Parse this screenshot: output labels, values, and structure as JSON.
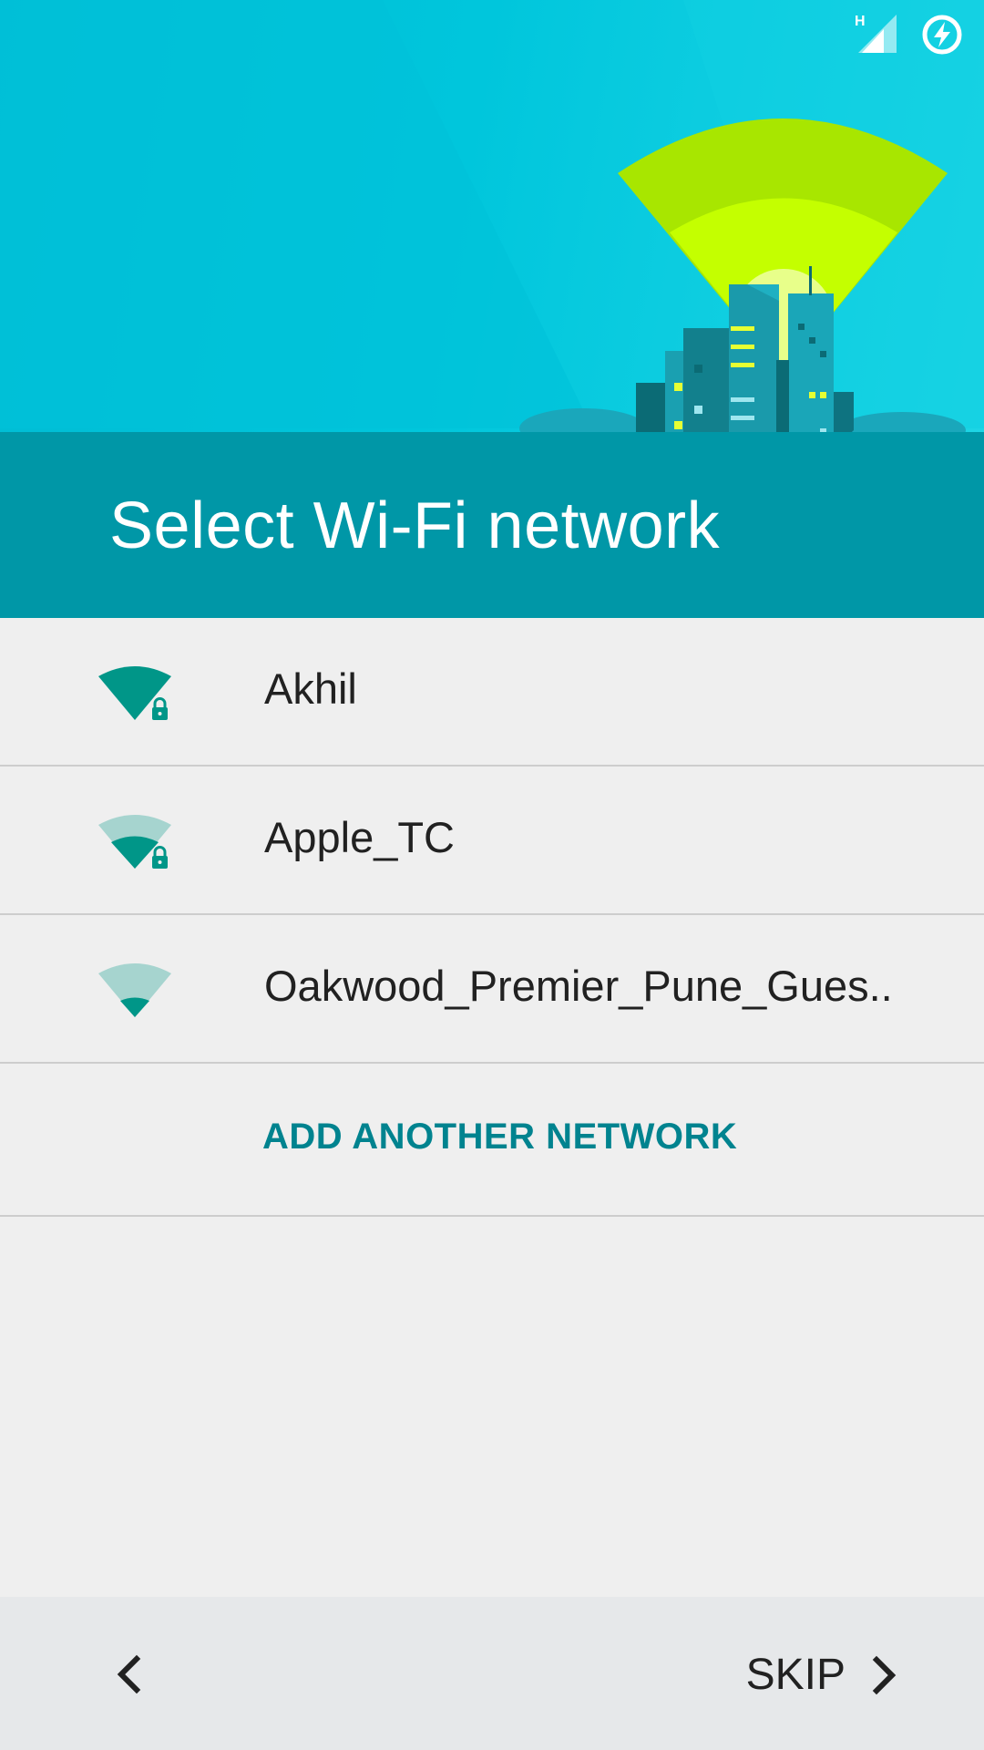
{
  "status_bar": {
    "network_type": "H",
    "icons": [
      "signal-icon",
      "battery-charging-icon"
    ]
  },
  "header": {
    "title": "Select Wi-Fi network",
    "illustration": "city-wifi-illustration"
  },
  "networks": [
    {
      "name": "Akhil",
      "icon": "wifi-strong-lock-icon",
      "signal": 4,
      "secured": true
    },
    {
      "name": "Apple_TC",
      "icon": "wifi-medium-lock-icon",
      "signal": 2,
      "secured": true
    },
    {
      "name": "Oakwood_Premier_Pune_Gues..",
      "icon": "wifi-weak-icon",
      "signal": 1,
      "secured": false
    }
  ],
  "add_network": {
    "label": "ADD ANOTHER NETWORK"
  },
  "footer": {
    "back_icon": "chevron-left-icon",
    "skip_label": "SKIP",
    "skip_icon": "chevron-right-icon"
  },
  "colors": {
    "header_sky": "#00bcd4",
    "header_band": "#0097a7",
    "accent": "#00838f",
    "wifi_strong": "#009688",
    "wifi_light": "#a6d4cf",
    "list_bg": "#efefef",
    "footer_bg": "#e6e8ea"
  }
}
